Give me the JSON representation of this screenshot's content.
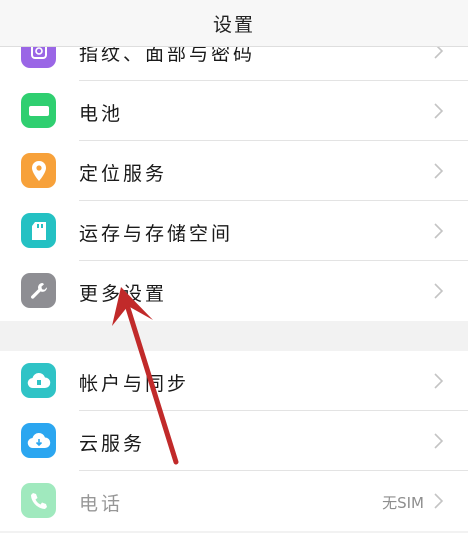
{
  "header": {
    "title": "设置"
  },
  "group1": [
    {
      "label": "指纹、面部与密码",
      "icon": "fingerprint-icon",
      "color": "#9a66e6"
    },
    {
      "label": "电池",
      "icon": "battery-icon",
      "color": "#2fcf70"
    },
    {
      "label": "定位服务",
      "icon": "location-pin-icon",
      "color": "#f7a13a"
    },
    {
      "label": "运存与存储空间",
      "icon": "sd-card-icon",
      "color": "#24c1c3"
    },
    {
      "label": "更多设置",
      "icon": "wrench-icon",
      "color": "#8e8e93"
    }
  ],
  "group2": [
    {
      "label": "帐户与同步",
      "icon": "cloud-account-icon",
      "color": "#2fc3c6"
    },
    {
      "label": "云服务",
      "icon": "cloud-icon",
      "color": "#2ba6f0"
    },
    {
      "label": "电话",
      "icon": "phone-icon",
      "color": "#2fcf70",
      "value": "无SIM"
    }
  ],
  "annotation": {
    "arrow_color": "#c12a2a",
    "points_to": "更多设置"
  }
}
